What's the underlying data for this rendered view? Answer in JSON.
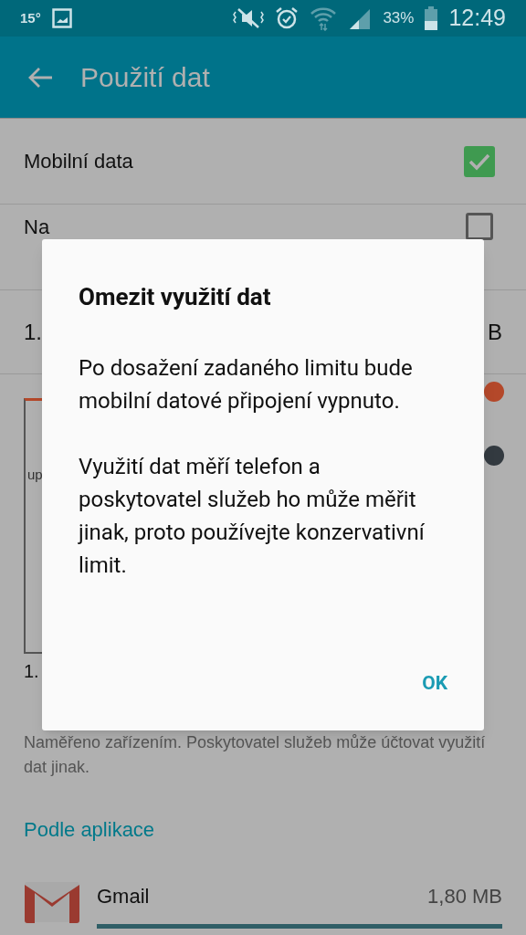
{
  "status_bar": {
    "temperature": "15°",
    "battery": "33%",
    "time": "12:49"
  },
  "app_bar": {
    "title": "Použití dat"
  },
  "settings": [
    {
      "kind": "checkbox",
      "label": "Mobilní data",
      "checked": true
    },
    {
      "kind": "checkbox",
      "label": "Na",
      "checked": false
    },
    {
      "kind": "range",
      "label": "1.",
      "value": "B"
    }
  ],
  "chart": {
    "limit_label": "up",
    "start_label": "1."
  },
  "note": "Naměřeno zařízením. Poskytovatel služeb může účtovat využití dat jinak.",
  "section_title": "Podle aplikace",
  "apps": [
    {
      "name": "Gmail",
      "usage": "1,80 MB",
      "level": 1
    }
  ],
  "dialog": {
    "title": "Omezit využití dat",
    "paragraphs": [
      "Po dosažení zadaného limitu bude mobilní datové připojení vypnuto.",
      "Využití dat měří telefon a poskytovatel služeb ho může měřit jinak, proto používejte konzervativní limit."
    ],
    "button": "OK"
  }
}
